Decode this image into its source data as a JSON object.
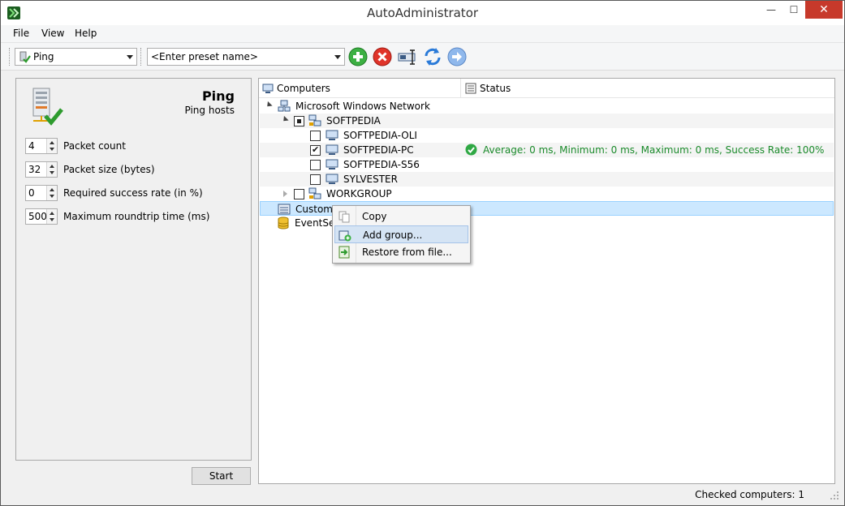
{
  "window": {
    "title": "AutoAdministrator",
    "close_glyph": "✕",
    "min_glyph": "—",
    "max_glyph": "☐"
  },
  "menu": {
    "file": "File",
    "view": "View",
    "help": "Help"
  },
  "toolbar": {
    "task_combo": "Ping",
    "preset_combo": "<Enter preset name>",
    "icons": [
      "add-icon",
      "delete-icon",
      "rename-icon",
      "refresh-icon",
      "forward-icon"
    ]
  },
  "task": {
    "title": "Ping",
    "subtitle": "Ping hosts",
    "params": [
      {
        "value": "4",
        "label": "Packet count"
      },
      {
        "value": "32",
        "label": "Packet size (bytes)"
      },
      {
        "value": "0",
        "label": "Required success rate (in %)"
      },
      {
        "value": "500",
        "label": "Maximum roundtrip time (ms)"
      }
    ],
    "start_label": "Start"
  },
  "tree": {
    "columns": {
      "computers": "Computers",
      "status": "Status"
    },
    "nodes": {
      "network": "Microsoft Windows Network",
      "softpedia": "SOFTPEDIA",
      "oli": "SOFTPEDIA-OLI",
      "pc": "SOFTPEDIA-PC",
      "pc_status": "Average: 0 ms, Minimum: 0 ms, Maximum: 0 ms, Success Rate: 100%",
      "s56": "SOFTPEDIA-S56",
      "sylvester": "SYLVESTER",
      "workgroup": "WORKGROUP",
      "custom": "Custom",
      "eventsen": "EventSen"
    }
  },
  "context_menu": {
    "copy": "Copy",
    "add_group": "Add group...",
    "restore": "Restore from file..."
  },
  "statusbar": {
    "checked": "Checked computers: 1"
  },
  "colors": {
    "status_ok": "#1a8a2a",
    "selection": "#cce8ff",
    "close": "#c7392b"
  }
}
